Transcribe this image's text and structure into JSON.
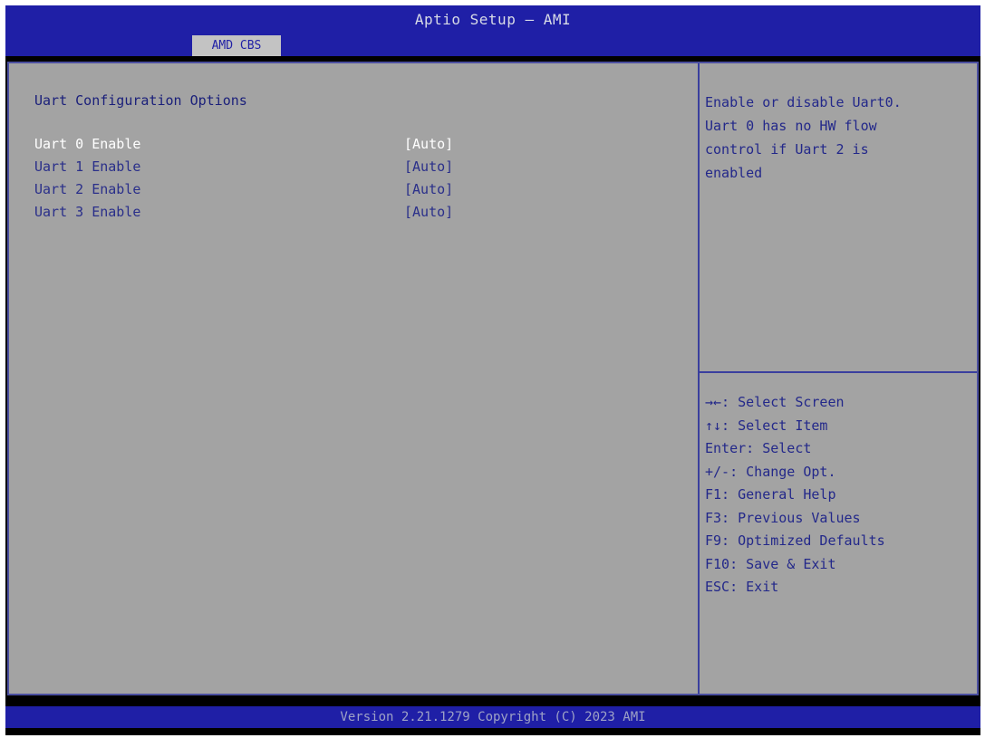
{
  "header": {
    "title": "Aptio Setup – AMI",
    "tabs": [
      {
        "label": "AMD CBS"
      }
    ]
  },
  "main": {
    "section_title": "Uart Configuration Options",
    "options": [
      {
        "label": "Uart 0 Enable",
        "value": "[Auto]",
        "selected": true
      },
      {
        "label": "Uart 1 Enable",
        "value": "[Auto]",
        "selected": false
      },
      {
        "label": "Uart 2 Enable",
        "value": "[Auto]",
        "selected": false
      },
      {
        "label": "Uart 3 Enable",
        "value": "[Auto]",
        "selected": false
      }
    ]
  },
  "help": {
    "lines": [
      "Enable or disable Uart0.",
      "Uart 0 has no HW flow",
      "control if Uart 2 is",
      "enabled"
    ]
  },
  "keys": [
    "→←: Select Screen",
    "↑↓: Select Item",
    "Enter: Select",
    "+/-: Change Opt.",
    "F1: General Help",
    "F3: Previous Values",
    "F9: Optimized Defaults",
    "F10: Save & Exit",
    "ESC: Exit"
  ],
  "footer": {
    "version": "Version 2.21.1279 Copyright (C) 2023 AMI"
  },
  "colors": {
    "header_blue": "#1f1fa6",
    "panel_gray": "#a3a3a3",
    "text_blue": "#23288a",
    "selected_text": "#ffffff"
  }
}
